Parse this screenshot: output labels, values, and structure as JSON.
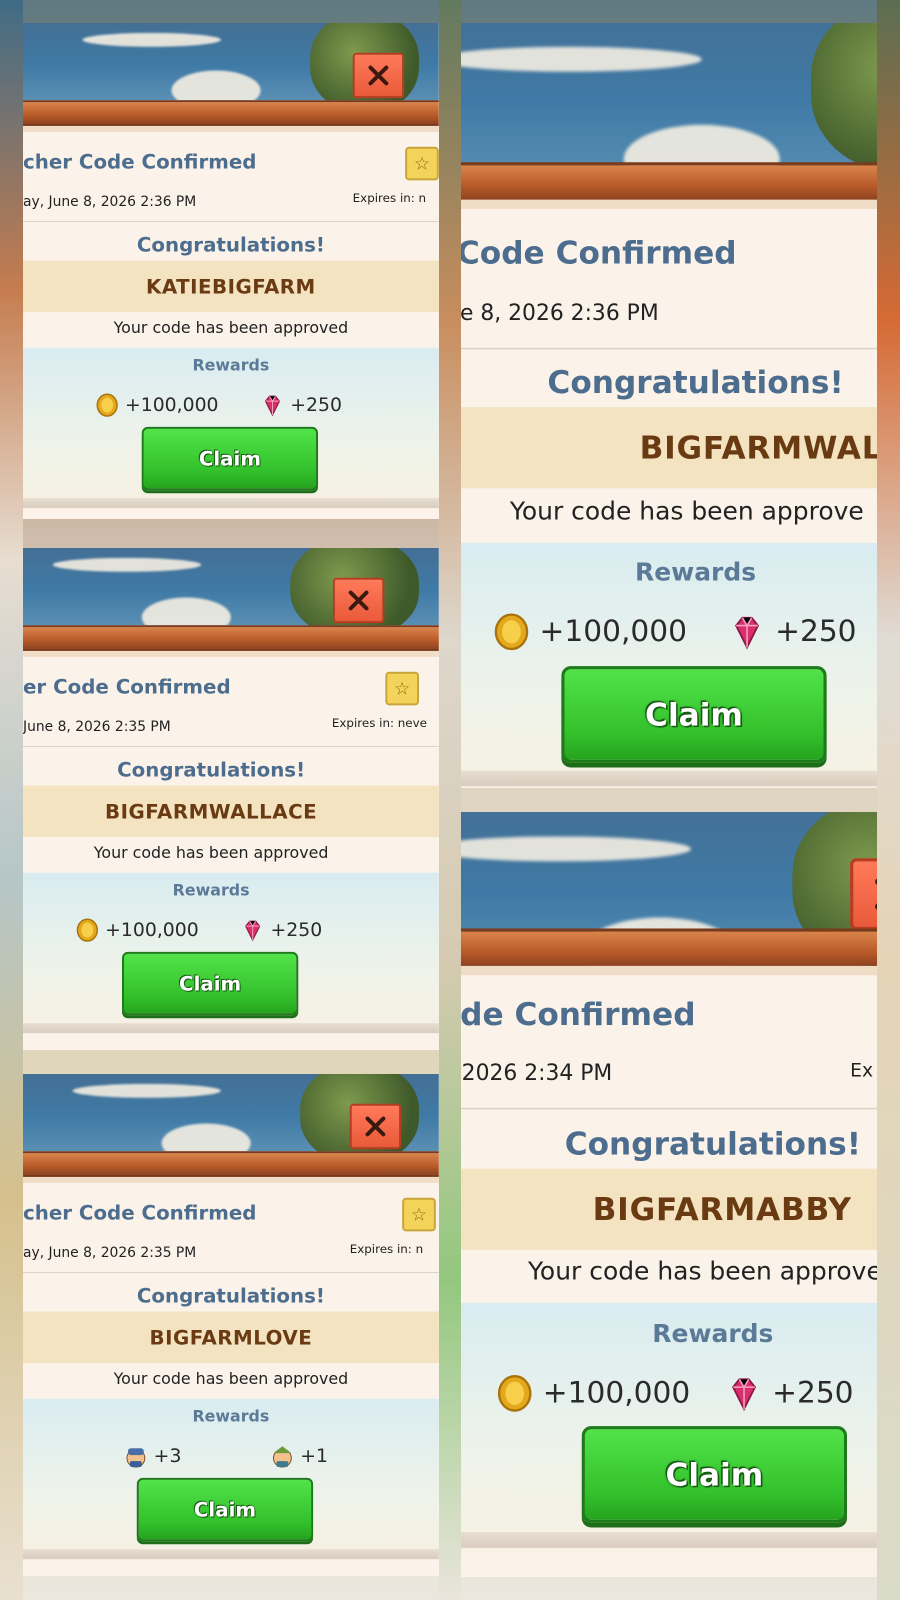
{
  "colors": {
    "title_blue": "#4d6d8e",
    "code_brown": "#6a3a12",
    "claim_green": "#33c22b",
    "close_red": "#e95a3a",
    "star_yellow": "#f4d35a"
  },
  "panels": [
    {
      "title": "cher Code Confirmed",
      "date": "ay, June 8, 2026 2:36 PM",
      "expires": "Expires in: n",
      "congrats": "Congratulations!",
      "code": "KATIEBIGFARM",
      "approved": "Your code has been approved",
      "rewards_label": "Rewards",
      "rewards": [
        {
          "icon": "gold-coin-icon",
          "amount": "+100,000"
        },
        {
          "icon": "gem-icon",
          "amount": "+250"
        }
      ],
      "claim": "Claim"
    },
    {
      "title": "er Code Confirmed",
      "date": "June 8, 2026 2:35 PM",
      "expires": "Expires in: neve",
      "congrats": "Congratulations!",
      "code": "BIGFARMWALLACE",
      "approved": "Your code has been approved",
      "rewards_label": "Rewards",
      "rewards": [
        {
          "icon": "gold-coin-icon",
          "amount": "+100,000"
        },
        {
          "icon": "gem-icon",
          "amount": "+250"
        }
      ],
      "claim": "Claim"
    },
    {
      "title": "cher Code Confirmed",
      "date": "ay, June 8, 2026 2:35 PM",
      "expires": "Expires in: n",
      "congrats": "Congratulations!",
      "code": "BIGFARMLOVE",
      "approved": "Your code has been approved",
      "rewards_label": "Rewards",
      "rewards": [
        {
          "icon": "farmer-icon",
          "amount": "+3"
        },
        {
          "icon": "farmhand-icon",
          "amount": "+1"
        }
      ],
      "claim": "Claim"
    },
    {
      "title": "Code Confirmed",
      "date": "e 8, 2026 2:36 PM",
      "expires": "",
      "congrats": "Congratulations!",
      "code": "BIGFARMWALLIS",
      "approved": "Your code has been approve",
      "rewards_label": "Rewards",
      "rewards": [
        {
          "icon": "gold-coin-icon",
          "amount": "+100,000"
        },
        {
          "icon": "gem-icon",
          "amount": "+250"
        }
      ],
      "claim": "Claim"
    },
    {
      "title": "de Confirmed",
      "date": "2026 2:34 PM",
      "expires": "Ex",
      "congrats": "Congratulations!",
      "code": "BIGFARMABBY",
      "approved": "Your code has been approved",
      "rewards_label": "Rewards",
      "rewards": [
        {
          "icon": "gold-coin-icon",
          "amount": "+100,000"
        },
        {
          "icon": "gem-icon",
          "amount": "+250"
        }
      ],
      "claim": "Claim"
    }
  ]
}
